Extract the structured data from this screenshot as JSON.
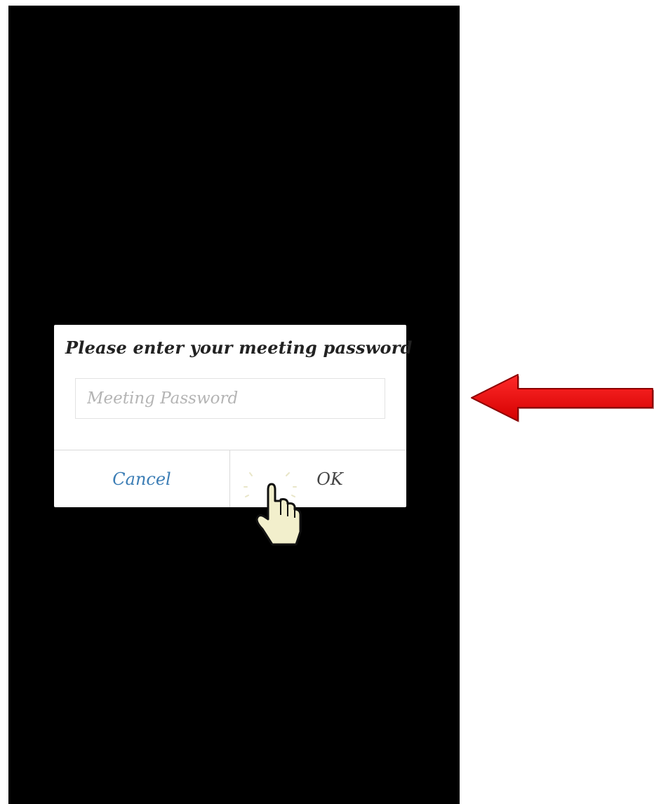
{
  "dialog": {
    "title": "Please enter your meeting password",
    "password_placeholder": "Meeting Password",
    "password_value": "",
    "cancel_label": "Cancel",
    "ok_label": "OK"
  },
  "colors": {
    "screen_background": "#000000",
    "dialog_background": "#ffffff",
    "cancel_text": "#3b7db5",
    "ok_text": "#444444",
    "arrow_fill": "#ee1111"
  },
  "icons": {
    "tap_cursor": "hand-pointer-icon",
    "annotation_arrow": "arrow-left-icon"
  }
}
